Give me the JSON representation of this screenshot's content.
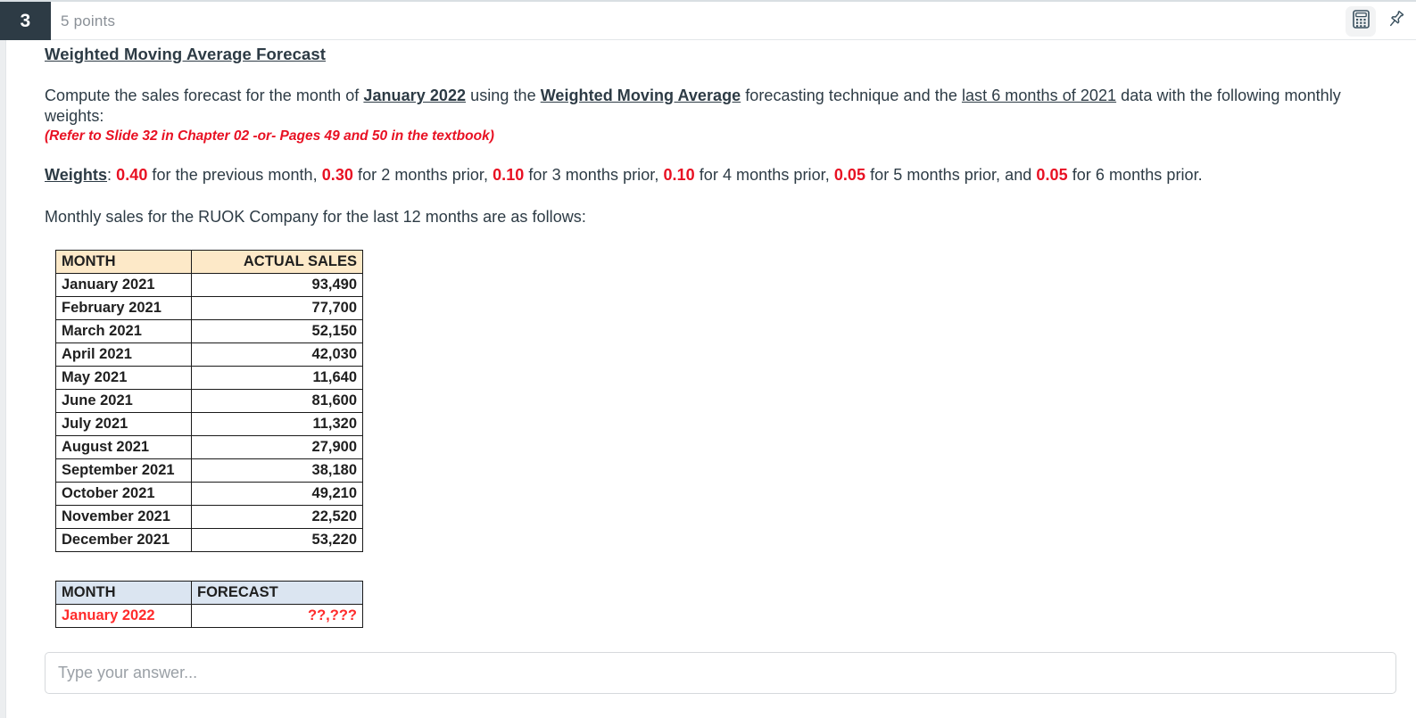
{
  "header": {
    "question_number": "3",
    "points": "5 points",
    "tools": [
      {
        "name": "calculator-icon",
        "label": "Calculator"
      },
      {
        "name": "pin-icon",
        "label": "Pin question"
      }
    ]
  },
  "question": {
    "title": "Weighted Moving Average Forecast",
    "prompt": {
      "p1": "Compute the sales forecast for the month of ",
      "emph_month": "January 2022",
      "p2": " using the ",
      "emph_technique": "Weighted Moving Average",
      "p3": " forecasting technique and the ",
      "emph_data": "last 6 months of 2021",
      "p4": " data with the following monthly weights:"
    },
    "reference_note": "(Refer to Slide 32 in Chapter 02 -or- Pages 49 and 50 in the textbook)",
    "weights_label": "Weights",
    "weights_sep": ": ",
    "weights_parts": [
      {
        "value": "0.40",
        "text": " for the previous month, "
      },
      {
        "value": "0.30",
        "text": " for 2 months prior, "
      },
      {
        "value": "0.10",
        "text": " for 3 months prior, "
      },
      {
        "value": "0.10",
        "text": " for 4 months prior, "
      },
      {
        "value": "0.05",
        "text": " for 5 months prior, and "
      },
      {
        "value": "0.05",
        "text": " for 6 months prior."
      }
    ],
    "sales_intro": "Monthly sales for the RUOK Company for the last 12 months are as follows:"
  },
  "sales_table": {
    "headers": {
      "month": "MONTH",
      "value": "ACTUAL SALES"
    },
    "rows": [
      {
        "month": "January 2021",
        "value": "93,490"
      },
      {
        "month": "February 2021",
        "value": "77,700"
      },
      {
        "month": "March 2021",
        "value": "52,150"
      },
      {
        "month": "April 2021",
        "value": "42,030"
      },
      {
        "month": "May 2021",
        "value": "11,640"
      },
      {
        "month": "June 2021",
        "value": "81,600"
      },
      {
        "month": "July 2021",
        "value": "11,320"
      },
      {
        "month": "August 2021",
        "value": "27,900"
      },
      {
        "month": "September 2021",
        "value": "38,180"
      },
      {
        "month": "October 2021",
        "value": "49,210"
      },
      {
        "month": "November 2021",
        "value": "22,520"
      },
      {
        "month": "December 2021",
        "value": "53,220"
      }
    ]
  },
  "forecast_table": {
    "headers": {
      "month": "MONTH",
      "value": "FORECAST"
    },
    "rows": [
      {
        "month": "January 2022",
        "value": "??,???"
      }
    ]
  },
  "answer": {
    "value": "",
    "placeholder": "Type your answer..."
  },
  "colors": {
    "badge": "#2d3b45",
    "text": "#2d3b45",
    "accent_red": "#e81123",
    "table_header_cream": "#fde9c8",
    "table_header_blue": "#dbe5f1",
    "forecast_red": "#ff2b2b"
  }
}
